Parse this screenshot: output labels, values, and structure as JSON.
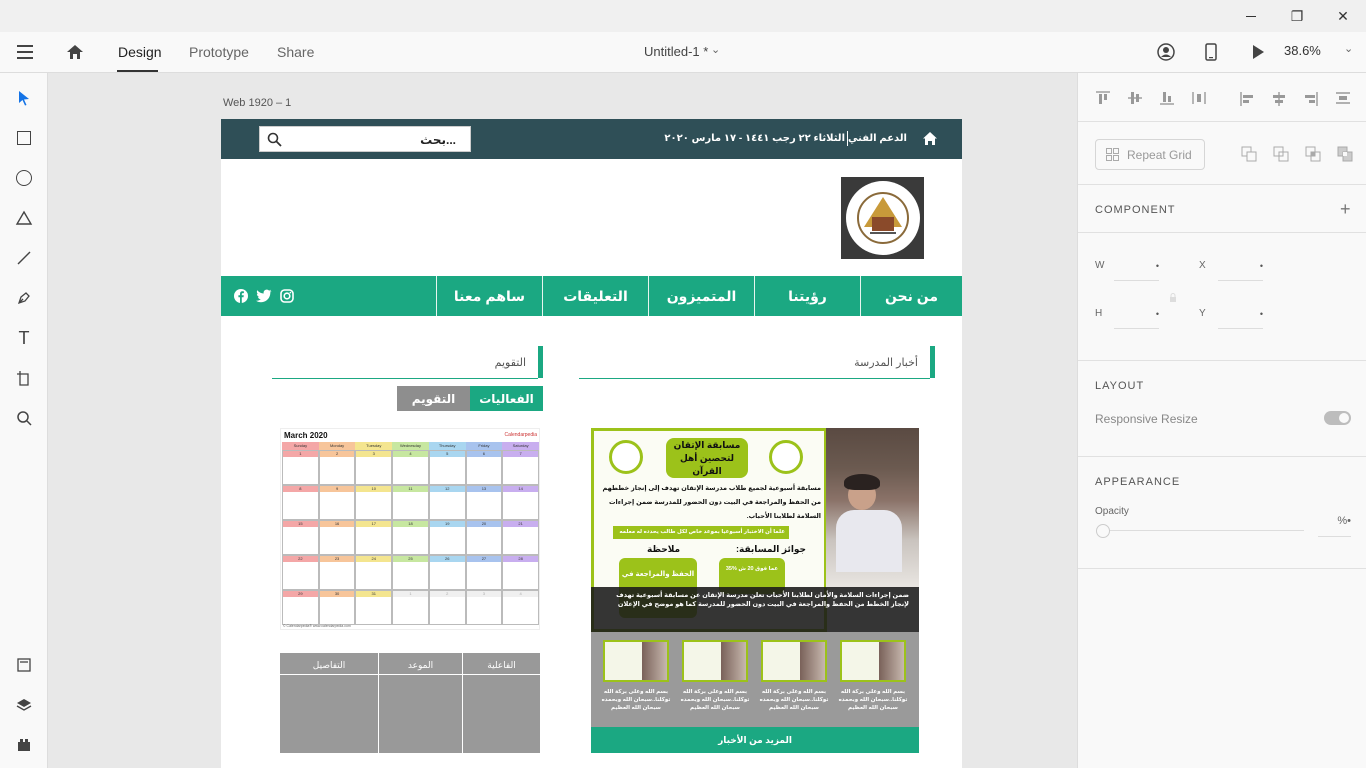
{
  "window": {
    "minimize": "—",
    "restore": "❐",
    "close": "✕"
  },
  "toolbar": {
    "design": "Design",
    "prototype": "Prototype",
    "share": "Share",
    "doc_title": "Untitled-1 *",
    "zoom": "38.6%"
  },
  "canvas": {
    "artboard_label": "Web 1920 – 1"
  },
  "site": {
    "search_placeholder": "بحث...",
    "header_date": "الثلاثاء ٢٢ رجب ١٤٤١ - ١٧ مارس ٢٠٢٠",
    "support": "الدعم الفني",
    "nav": [
      "من نحن",
      "رؤيتنا",
      "المتميزون",
      "التعليقات",
      "ساهم معنا"
    ],
    "calendar_title": "التقويم",
    "news_title": "أخبار المدرسة",
    "tab_events": "الفعاليات",
    "tab_calendar": "التقويم",
    "table_headers": [
      "الفاعلية",
      "الموعد",
      "التفاصيل"
    ],
    "cal_month": "March 2020",
    "cal_brand": "Calendarpedia",
    "cal_days": [
      "Sunday",
      "Monday",
      "Tuesday",
      "Wednesday",
      "Thursday",
      "Friday",
      "Saturday"
    ],
    "cal_dates": [
      "1",
      "2",
      "3",
      "4",
      "5",
      "6",
      "7",
      "8",
      "9",
      "10",
      "11",
      "12",
      "13",
      "14",
      "15",
      "16",
      "17",
      "18",
      "19",
      "20",
      "21",
      "22",
      "23",
      "24",
      "25",
      "26",
      "27",
      "28",
      "29",
      "30",
      "31",
      "1",
      "2",
      "3",
      "4"
    ],
    "cal_footer_left": "© Calendarpedia®   www.calendarpedia.com",
    "poster_title": "مسابقة الإتقان لتحصين أهل القرآن",
    "poster_desc": "مسابقة أسبوعية لجميع طلاب مدرسة الإتقان تهدف إلى إنجاز خططهم من الحفظ والمراجعة في البيت دون الحضور للمدرسة ضمن إجراءات السلامة لطلابنا الأحباب.",
    "poster_note": "علما أن الاختبار أسبوعيا بموعد خاص لكل طالب يحدده له معلمه",
    "poster_prizes": "جوائز المسابقة:",
    "poster_remark": "ملاحظة",
    "poster_prize1": "35% عما فوق 20 ش",
    "poster_remark1": "الحفظ والمراجعة في",
    "news_caption": "ضمن إجراءات السلامة والأمان لطلابنا الأحباب تعلن مدرسة الإتقان عن مسابقة أسبوعية تهدف لإنجاز الخطط من الحفظ والمراجعة في البيت دون الحضور للمدرسة كما هو موضح في الإعلان",
    "thumb_caption": "بسم الله وعلى بركة الله توكلنا..سبحان الله وبحمده سبحان الله العظيم",
    "more_news": "المزيد من الأخبار"
  },
  "panel": {
    "repeat_grid": "Repeat Grid",
    "component": "COMPONENT",
    "w_label": "W",
    "h_label": "H",
    "x_label": "X",
    "y_label": "Y",
    "dot": "•",
    "layout": "LAYOUT",
    "responsive": "Responsive Resize",
    "appearance": "APPEARANCE",
    "opacity": "Opacity",
    "opacity_value": "%•"
  },
  "colors": {
    "header": "#2f4f57",
    "nav": "#1ba882",
    "poster_green": "#9cc21a"
  }
}
